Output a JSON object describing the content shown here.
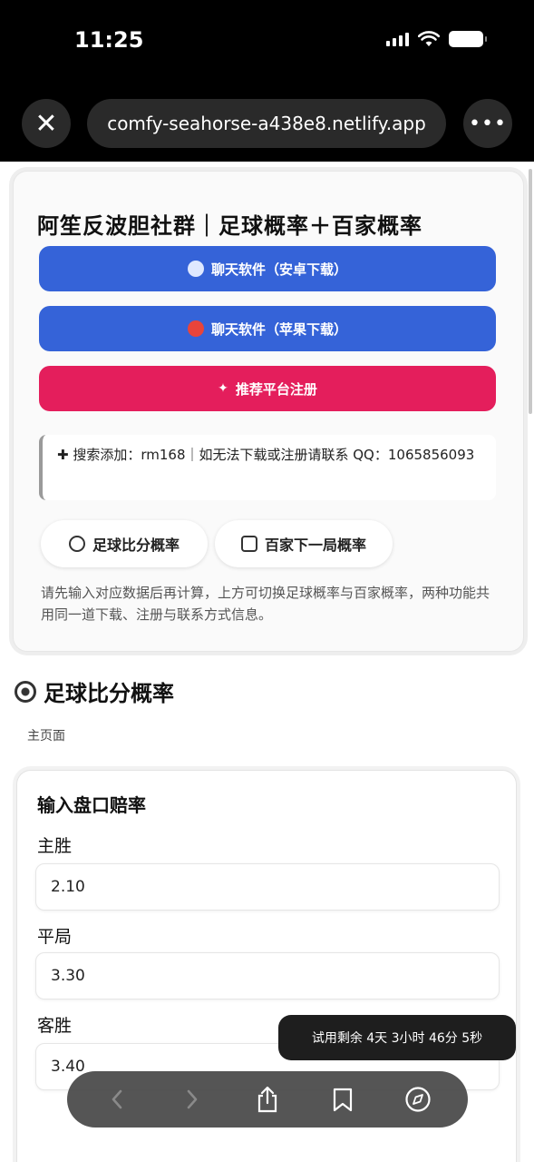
{
  "status_bar": {
    "time": "11:25"
  },
  "browser": {
    "url": "comfy-seahorse-a438e8.netlify.app",
    "close_glyph": "✕",
    "more_glyph": "•••"
  },
  "hero": {
    "title": "阿笙反波胆社群｜足球概率＋百家概率",
    "buttons": [
      {
        "label": "聊天软件（安卓下载）",
        "icon": "chat-bubble-icon",
        "color": "#3563d8"
      },
      {
        "label": "聊天软件（苹果下载）",
        "icon": "apple-icon",
        "color": "#3563d8"
      },
      {
        "label": "推荐平台注册",
        "icon": "star-icon",
        "color": "#e41e5c"
      }
    ],
    "notice": "✚ 搜索添加：rm168｜如无法下载或注册请联系 QQ：1065856093",
    "tabs": [
      {
        "label": "足球比分概率",
        "icon": "soccer-ball-icon"
      },
      {
        "label": "百家下一局概率",
        "icon": "dice-icon"
      }
    ],
    "hint": "请先输入对应数据后再计算，上方可切换足球概率与百家概率，两种功能共用同一道下载、注册与联系方式信息。"
  },
  "section": {
    "title": "足球比分概率",
    "subnote": "主页面"
  },
  "card": {
    "title": "输入盘口赔率",
    "fields": [
      {
        "label": "主胜",
        "value": "2.10"
      },
      {
        "label": "平局",
        "value": "3.30"
      },
      {
        "label": "客胜",
        "value": "3.40"
      }
    ]
  },
  "trial": {
    "text": "试用剩余 4天 3小时 46分 5秒"
  },
  "toolbar": {
    "items": [
      {
        "icon": "back-icon"
      },
      {
        "icon": "forward-icon"
      },
      {
        "icon": "share-icon"
      },
      {
        "icon": "bookmarks-icon"
      },
      {
        "icon": "compass-icon"
      }
    ]
  }
}
